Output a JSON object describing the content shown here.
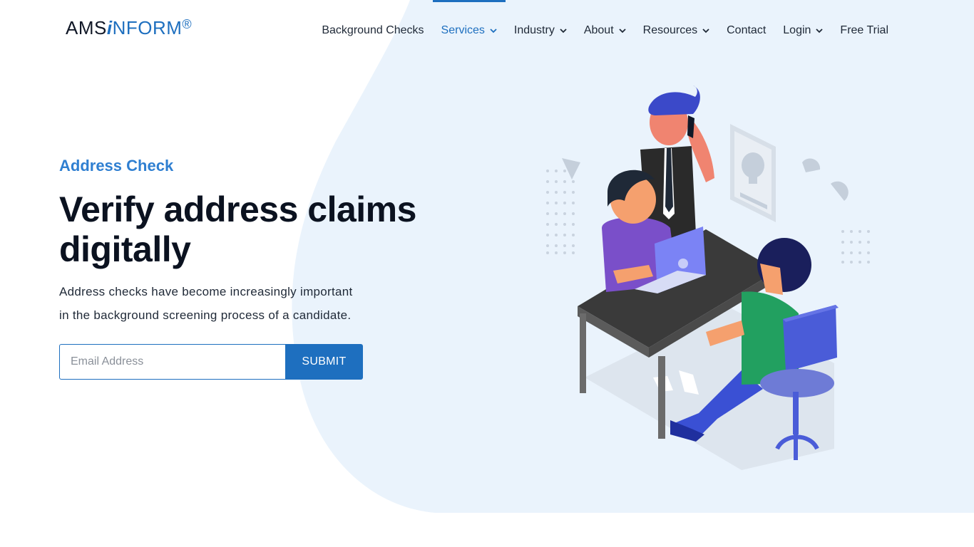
{
  "brand": {
    "prefix": "AMS",
    "accent": "i",
    "rest": "NFORM",
    "reg": "®"
  },
  "nav": {
    "items": [
      {
        "label": "Background Checks",
        "has_dropdown": false,
        "active": false
      },
      {
        "label": "Services",
        "has_dropdown": true,
        "active": true
      },
      {
        "label": "Industry",
        "has_dropdown": true,
        "active": false
      },
      {
        "label": "About",
        "has_dropdown": true,
        "active": false
      },
      {
        "label": "Resources",
        "has_dropdown": true,
        "active": false
      },
      {
        "label": "Contact",
        "has_dropdown": false,
        "active": false
      },
      {
        "label": "Login",
        "has_dropdown": true,
        "active": false
      },
      {
        "label": "Free Trial",
        "has_dropdown": false,
        "active": false
      }
    ]
  },
  "hero": {
    "eyebrow": "Address Check",
    "title_line1": "Verify address claims",
    "title_line2": "digitally",
    "description": "Address checks have become increasingly important in the background screening process of a candidate."
  },
  "form": {
    "email_placeholder": "Email Address",
    "email_value": "",
    "submit_label": "SUBMIT"
  },
  "colors": {
    "accent": "#1e6fbf",
    "eyebrow": "#2f7fd1",
    "blob": "#eaf3fc",
    "heading": "#0b1220"
  },
  "illustration": {
    "icon": "office-team-illustration"
  }
}
